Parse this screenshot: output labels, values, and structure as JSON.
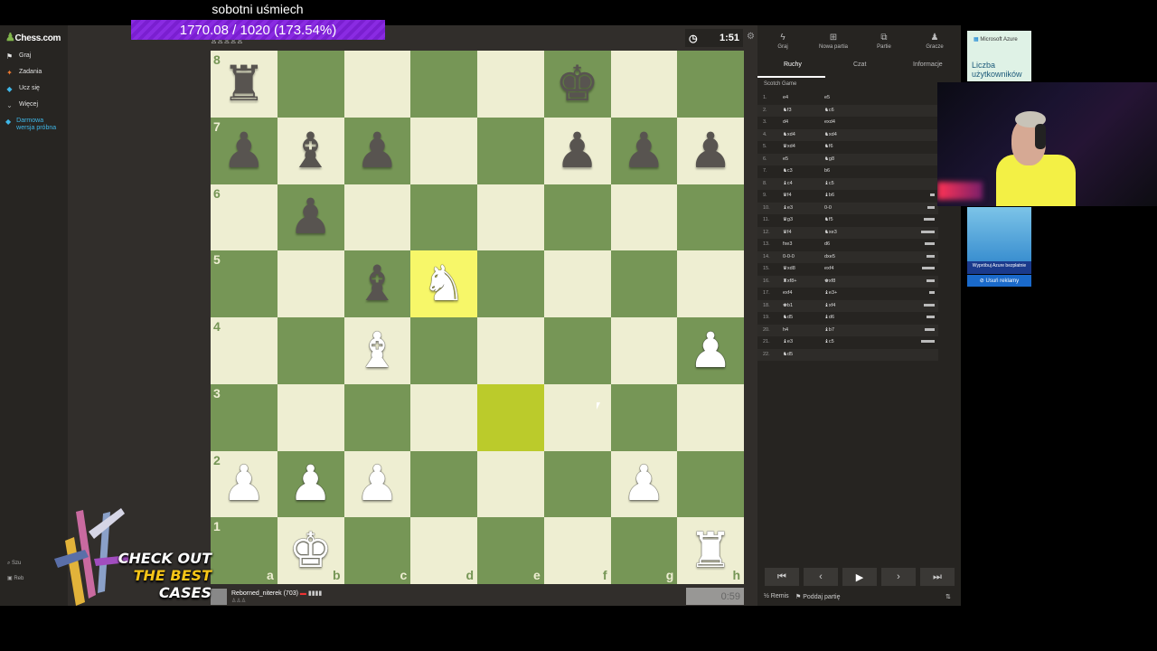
{
  "stream": {
    "title": "sobotni uśmiech",
    "progress_text": "1770.08 / 1020 (173.54%)",
    "progress_percent": 173.54
  },
  "sidebar": {
    "logo": "Chess.com",
    "items": [
      {
        "label": "Graj",
        "icon": "play-icon"
      },
      {
        "label": "Zadania",
        "icon": "puzzle-icon"
      },
      {
        "label": "Ucz się",
        "icon": "learn-icon"
      },
      {
        "label": "Więcej",
        "icon": "chevron-down-icon"
      },
      {
        "label": "Darmowa wersja próbna",
        "icon": "diamond-icon"
      }
    ],
    "bottom": [
      "Szu",
      "Reb"
    ]
  },
  "game": {
    "timer_top": "1:51",
    "timer_bottom": "0:59",
    "player_bottom": "Reborned_niterek (703)",
    "highlight_squares": [
      "d5",
      "e3"
    ],
    "ranks": [
      "8",
      "7",
      "6",
      "5",
      "4",
      "3",
      "2",
      "1"
    ],
    "files": [
      "a",
      "b",
      "c",
      "d",
      "e",
      "f",
      "g",
      "h"
    ],
    "pieces": [
      {
        "sq": "a8",
        "color": "b",
        "glyph": "♜"
      },
      {
        "sq": "f8",
        "color": "b",
        "glyph": "♚"
      },
      {
        "sq": "a7",
        "color": "b",
        "glyph": "♟"
      },
      {
        "sq": "b7",
        "color": "b",
        "glyph": "♝"
      },
      {
        "sq": "c7",
        "color": "b",
        "glyph": "♟"
      },
      {
        "sq": "f7",
        "color": "b",
        "glyph": "♟"
      },
      {
        "sq": "g7",
        "color": "b",
        "glyph": "♟"
      },
      {
        "sq": "h7",
        "color": "b",
        "glyph": "♟"
      },
      {
        "sq": "b6",
        "color": "b",
        "glyph": "♟"
      },
      {
        "sq": "c5",
        "color": "b",
        "glyph": "♝"
      },
      {
        "sq": "d5",
        "color": "w",
        "glyph": "♞"
      },
      {
        "sq": "c4",
        "color": "w",
        "glyph": "♝"
      },
      {
        "sq": "h4",
        "color": "w",
        "glyph": "♟"
      },
      {
        "sq": "a2",
        "color": "w",
        "glyph": "♟"
      },
      {
        "sq": "b2",
        "color": "w",
        "glyph": "♟"
      },
      {
        "sq": "c2",
        "color": "w",
        "glyph": "♟"
      },
      {
        "sq": "g2",
        "color": "w",
        "glyph": "♟"
      },
      {
        "sq": "b1",
        "color": "w",
        "glyph": "♚"
      },
      {
        "sq": "h1",
        "color": "w",
        "glyph": "♜"
      }
    ]
  },
  "panel": {
    "tabs": [
      {
        "label": "Graj",
        "icon": "bolt-icon"
      },
      {
        "label": "Nowa partia",
        "icon": "plus-icon"
      },
      {
        "label": "Partie",
        "icon": "games-icon"
      },
      {
        "label": "Gracze",
        "icon": "players-icon"
      }
    ],
    "subtabs": [
      "Ruchy",
      "Czat",
      "Informacje"
    ],
    "opening": "Scotch Game",
    "moves": [
      {
        "n": "1.",
        "w": "e4",
        "b": "e5"
      },
      {
        "n": "2.",
        "w": "♞f3",
        "b": "♞c6"
      },
      {
        "n": "3.",
        "w": "d4",
        "b": "exd4"
      },
      {
        "n": "4.",
        "w": "♞xd4",
        "b": "♞xd4"
      },
      {
        "n": "5.",
        "w": "♛xd4",
        "b": "♞f6"
      },
      {
        "n": "6.",
        "w": "e5",
        "b": "♞g8"
      },
      {
        "n": "7.",
        "w": "♞c3",
        "b": "b6"
      },
      {
        "n": "8.",
        "w": "♝c4",
        "b": "♝c5"
      },
      {
        "n": "9.",
        "w": "♛f4",
        "b": "♝b6"
      },
      {
        "n": "10.",
        "w": "♝e3",
        "b": "0-0"
      },
      {
        "n": "11.",
        "w": "♛g3",
        "b": "♞f5"
      },
      {
        "n": "12.",
        "w": "♛f4",
        "b": "♞xe3"
      },
      {
        "n": "13.",
        "w": "fxe3",
        "b": "d6"
      },
      {
        "n": "14.",
        "w": "0-0-0",
        "b": "dxe5"
      },
      {
        "n": "15.",
        "w": "♛xd8",
        "b": "exf4"
      },
      {
        "n": "16.",
        "w": "♜xf8+",
        "b": "♚xf8"
      },
      {
        "n": "17.",
        "w": "exf4",
        "b": "♝e3+"
      },
      {
        "n": "18.",
        "w": "♚b1",
        "b": "♝xf4"
      },
      {
        "n": "19.",
        "w": "♞d5",
        "b": "♝d6"
      },
      {
        "n": "20.",
        "w": "h4",
        "b": "♝b7"
      },
      {
        "n": "21.",
        "w": "♝e3",
        "b": "♝c5"
      },
      {
        "n": "22.",
        "w": "♞d5",
        "b": ""
      }
    ],
    "nav": [
      "⏮",
      "‹",
      "▶",
      "›",
      "⏭"
    ],
    "footer_draw": "Remis",
    "footer_resign": "Poddaj partię"
  },
  "ad": {
    "brand": "Microsoft Azure",
    "heading": "Liczba użytkowników",
    "cta": "Wypróbuj Azure bezpłatnie",
    "remove": "Usuń reklamy"
  },
  "promo": {
    "line1": "CHECK OUT",
    "line2": "THE BEST",
    "line3": "CASES"
  }
}
